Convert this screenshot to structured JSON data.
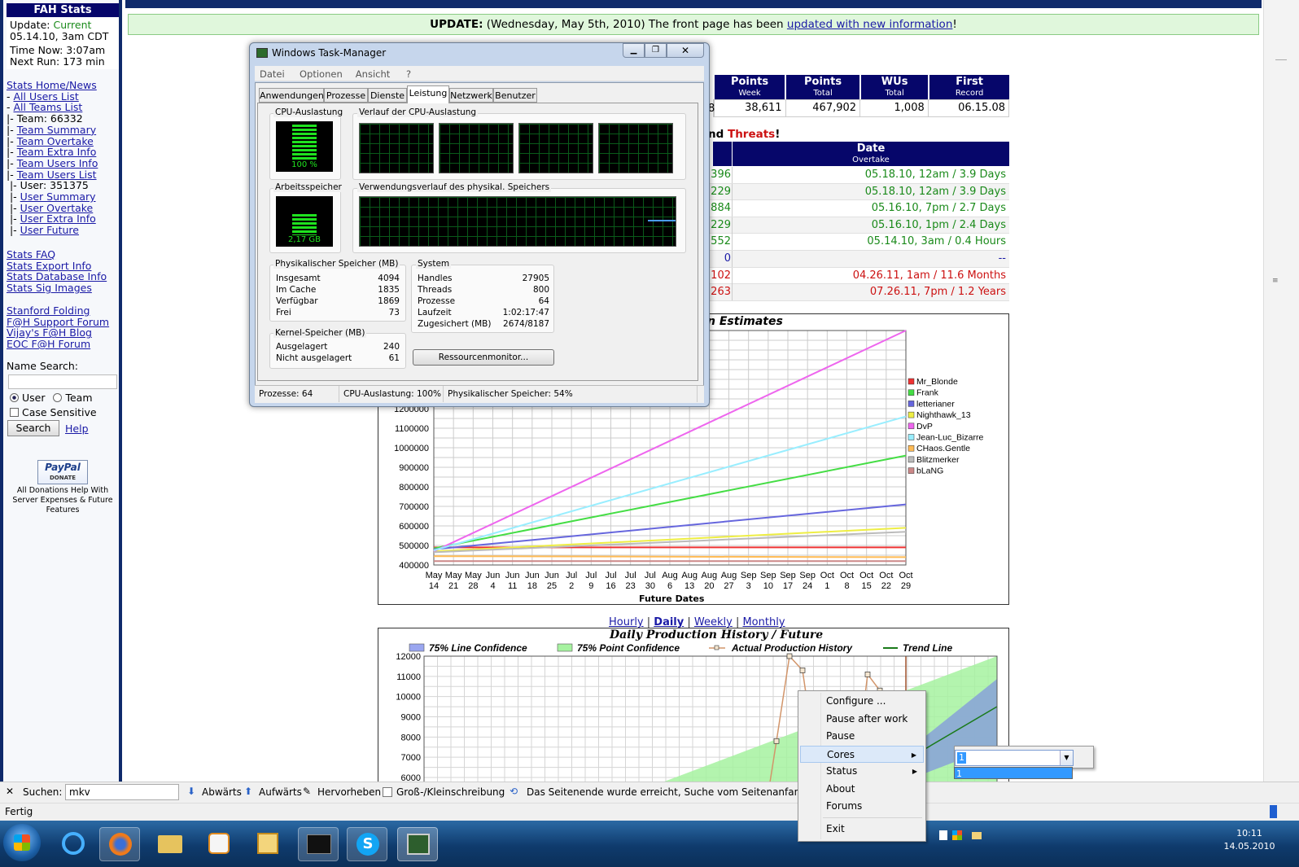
{
  "sidebar": {
    "title": "FAH Stats",
    "update_label": "Update:",
    "update_value": "Current",
    "update_date": "05.14.10, 3am CDT",
    "time_now": "Time Now: 3:07am",
    "next_run": "Next Run: 173 min",
    "links": [
      {
        "text": "Stats Home/News",
        "link": true,
        "prefix": ""
      },
      {
        "text": "All Users List",
        "link": true,
        "prefix": "- "
      },
      {
        "text": "All Teams List",
        "link": true,
        "prefix": "- "
      },
      {
        "text": "Team: 66332",
        "link": false,
        "prefix": "|- "
      },
      {
        "text": "Team Summary",
        "link": true,
        "prefix": "|- "
      },
      {
        "text": "Team Overtake",
        "link": true,
        "prefix": "|- "
      },
      {
        "text": "Team Extra Info",
        "link": true,
        "prefix": "|- "
      },
      {
        "text": "Team Users Info",
        "link": true,
        "prefix": "|- "
      },
      {
        "text": "Team Users List",
        "link": true,
        "prefix": "|- "
      },
      {
        "text": "User: 351375",
        "link": false,
        "prefix": " |- "
      },
      {
        "text": "User Summary",
        "link": true,
        "prefix": " |- "
      },
      {
        "text": "User Overtake",
        "link": true,
        "prefix": " |- "
      },
      {
        "text": "User Extra Info",
        "link": true,
        "prefix": " |- "
      },
      {
        "text": "User Future",
        "link": true,
        "prefix": " |- "
      }
    ],
    "links2": [
      "Stats FAQ",
      "Stats Export Info",
      "Stats Database Info",
      "Stats Sig Images"
    ],
    "links3": [
      "Stanford Folding",
      "F@H Support Forum",
      "Vijay's F@H Blog",
      "EOC F@H Forum"
    ],
    "name_search_label": "Name Search:",
    "radio_user": "User",
    "radio_team": "Team",
    "case_sensitive": "Case Sensitive",
    "search_button": "Search",
    "help_link": "Help",
    "paypal": "PayPal",
    "paypal_sub": "DONATE",
    "donation_text": "All Donations Help With Server Expenses & Future Features"
  },
  "update_banner": {
    "label": "UPDATE:",
    "text": " (Wednesday, May 5th, 2010) The front page has been ",
    "link": "updated with new information",
    "end": "!"
  },
  "summary_table": {
    "headers": [
      [
        "Points",
        "Week"
      ],
      [
        "Points",
        "Total"
      ],
      [
        "WUs",
        "Total"
      ],
      [
        "First",
        "Record"
      ]
    ],
    "row": [
      "38,611",
      "467,902",
      "1,008",
      "06.15.08"
    ],
    "partial_first": "8"
  },
  "threats": {
    "heading_a": "nd ",
    "heading_b": "Threats",
    "heading_c": "!",
    "date_header": "Date",
    "date_sub": "Overtake",
    "rows": [
      {
        "left": "396",
        "date": "05.18.10, 12am / 3.9 Days",
        "color": "#1a8a1a"
      },
      {
        "left": "229",
        "date": "05.18.10, 12am / 3.9 Days",
        "color": "#1a8a1a"
      },
      {
        "left": "884",
        "date": "05.16.10, 7pm / 2.7 Days",
        "color": "#1a8a1a"
      },
      {
        "left": "229",
        "date": "05.16.10, 1pm / 2.4 Days",
        "color": "#1a8a1a"
      },
      {
        "left": "552",
        "date": "05.14.10, 3am / 0.4 Hours",
        "color": "#1a8a1a"
      },
      {
        "left": "0",
        "date": "--",
        "color": "#1a1aa6"
      },
      {
        "left": "102",
        "date": "04.26.11, 1am / 11.6 Months",
        "color": "#cc1111"
      },
      {
        "left": "263",
        "date": "07.26.11, 7pm / 1.2 Years",
        "color": "#cc1111"
      }
    ]
  },
  "chart_data": [
    {
      "type": "line",
      "title": "n Estimates",
      "xlabel": "Future Dates",
      "ylabel": "",
      "ylim": [
        400000,
        1600000
      ],
      "yticks": [
        400000,
        500000,
        600000,
        700000,
        800000,
        900000,
        1000000,
        1100000,
        1200000
      ],
      "x_ticks": [
        "May 14",
        "May 21",
        "May 28",
        "Jun 4",
        "Jun 11",
        "Jun 18",
        "Jun 25",
        "Jul 2",
        "Jul 9",
        "Jul 16",
        "Jul 23",
        "Jul 30",
        "Aug 6",
        "Aug 13",
        "Aug 20",
        "Aug 27",
        "Sep 3",
        "Sep 10",
        "Sep 17",
        "Sep 24",
        "Oct 1",
        "Oct 8",
        "Oct 15",
        "Oct 22",
        "Oct 29"
      ],
      "legend_position": "right",
      "series": [
        {
          "name": "Mr_Blonde",
          "color": "#ee3333",
          "start": 490000,
          "end": 490000
        },
        {
          "name": "Frank",
          "color": "#44dd44",
          "start": 485000,
          "end": 960000
        },
        {
          "name": "letterianer",
          "color": "#6666dd",
          "start": 480000,
          "end": 710000
        },
        {
          "name": "Nighthawk_13",
          "color": "#eeee44",
          "start": 470000,
          "end": 590000
        },
        {
          "name": "DvP",
          "color": "#ee66ee",
          "start": 470000,
          "end": 1600000
        },
        {
          "name": "Jean-Luc_Bizarre",
          "color": "#99eeff",
          "start": 475000,
          "end": 1160000
        },
        {
          "name": "CHaos.Gentle",
          "color": "#ffbb55",
          "start": 445000,
          "end": 440000
        },
        {
          "name": "Blitzmerker",
          "color": "#bbbbbb",
          "start": 465000,
          "end": 570000
        },
        {
          "name": "bLaNG",
          "color": "#cc8888",
          "start": 420000,
          "end": 420000
        }
      ]
    },
    {
      "type": "line",
      "title": "Daily Production History / Future",
      "ylim": [
        6000,
        12000
      ],
      "yticks": [
        6000,
        7000,
        8000,
        9000,
        10000,
        11000,
        12000
      ],
      "legend": [
        "75% Line Confidence",
        "75% Point Confidence",
        "Actual Production History",
        "Trend Line"
      ],
      "series": [
        {
          "name": "Actual Production History",
          "values": [
            5500,
            7800,
            12000,
            11300,
            5500,
            6200,
            11100,
            10300
          ]
        }
      ]
    }
  ],
  "history_tabs": [
    "Hourly",
    "Daily",
    "Weekly",
    "Monthly"
  ],
  "task_manager": {
    "title": "Windows Task-Manager",
    "menu": [
      "Datei",
      "Optionen",
      "Ansicht",
      "?"
    ],
    "tabs": [
      "Anwendungen",
      "Prozesse",
      "Dienste",
      "Leistung",
      "Netzwerk",
      "Benutzer"
    ],
    "active_tab": "Leistung",
    "cpu_label": "CPU-Auslastung",
    "cpu_value": "100 %",
    "cpu_history_label": "Verlauf der CPU-Auslastung",
    "mem_label": "Arbeitsspeicher",
    "mem_value": "2,17 GB",
    "mem_history_label": "Verwendungsverlauf des physikal. Speichers",
    "phys_label": "Physikalischer Speicher (MB)",
    "phys": [
      [
        "Insgesamt",
        "4094"
      ],
      [
        "Im Cache",
        "1835"
      ],
      [
        "Verfügbar",
        "1869"
      ],
      [
        "Frei",
        "73"
      ]
    ],
    "system_label": "System",
    "system": [
      [
        "Handles",
        "27905"
      ],
      [
        "Threads",
        "800"
      ],
      [
        "Prozesse",
        "64"
      ],
      [
        "Laufzeit",
        "1:02:17:47"
      ],
      [
        "Zugesichert (MB)",
        "2674/8187"
      ]
    ],
    "kernel_label": "Kernel-Speicher (MB)",
    "kernel": [
      [
        "Ausgelagert",
        "240"
      ],
      [
        "Nicht ausgelagert",
        "61"
      ]
    ],
    "resmon_button": "Ressourcenmonitor...",
    "status": [
      "Prozesse: 64",
      "CPU-Auslastung: 100%",
      "Physikalischer Speicher: 54%"
    ]
  },
  "context_menu": {
    "items": [
      "Configure ...",
      "Pause after work",
      "Pause",
      "Cores",
      "Status",
      "About",
      "Forums",
      "Exit"
    ],
    "highlighted": "Cores",
    "cores_value": "1",
    "cores_option": "1"
  },
  "findbar": {
    "label": "Suchen:",
    "value": "mkv",
    "down": "Abwärts",
    "up": "Aufwärts",
    "highlight": "Hervorheben",
    "case": "Groß-/Kleinschreibung",
    "message": "Das Seitenende wurde erreicht, Suche vom Seitenanfang fortges"
  },
  "statusbar": {
    "text": "Fertig"
  },
  "taskbar": {
    "time": "10:11",
    "date": "14.05.2010"
  }
}
